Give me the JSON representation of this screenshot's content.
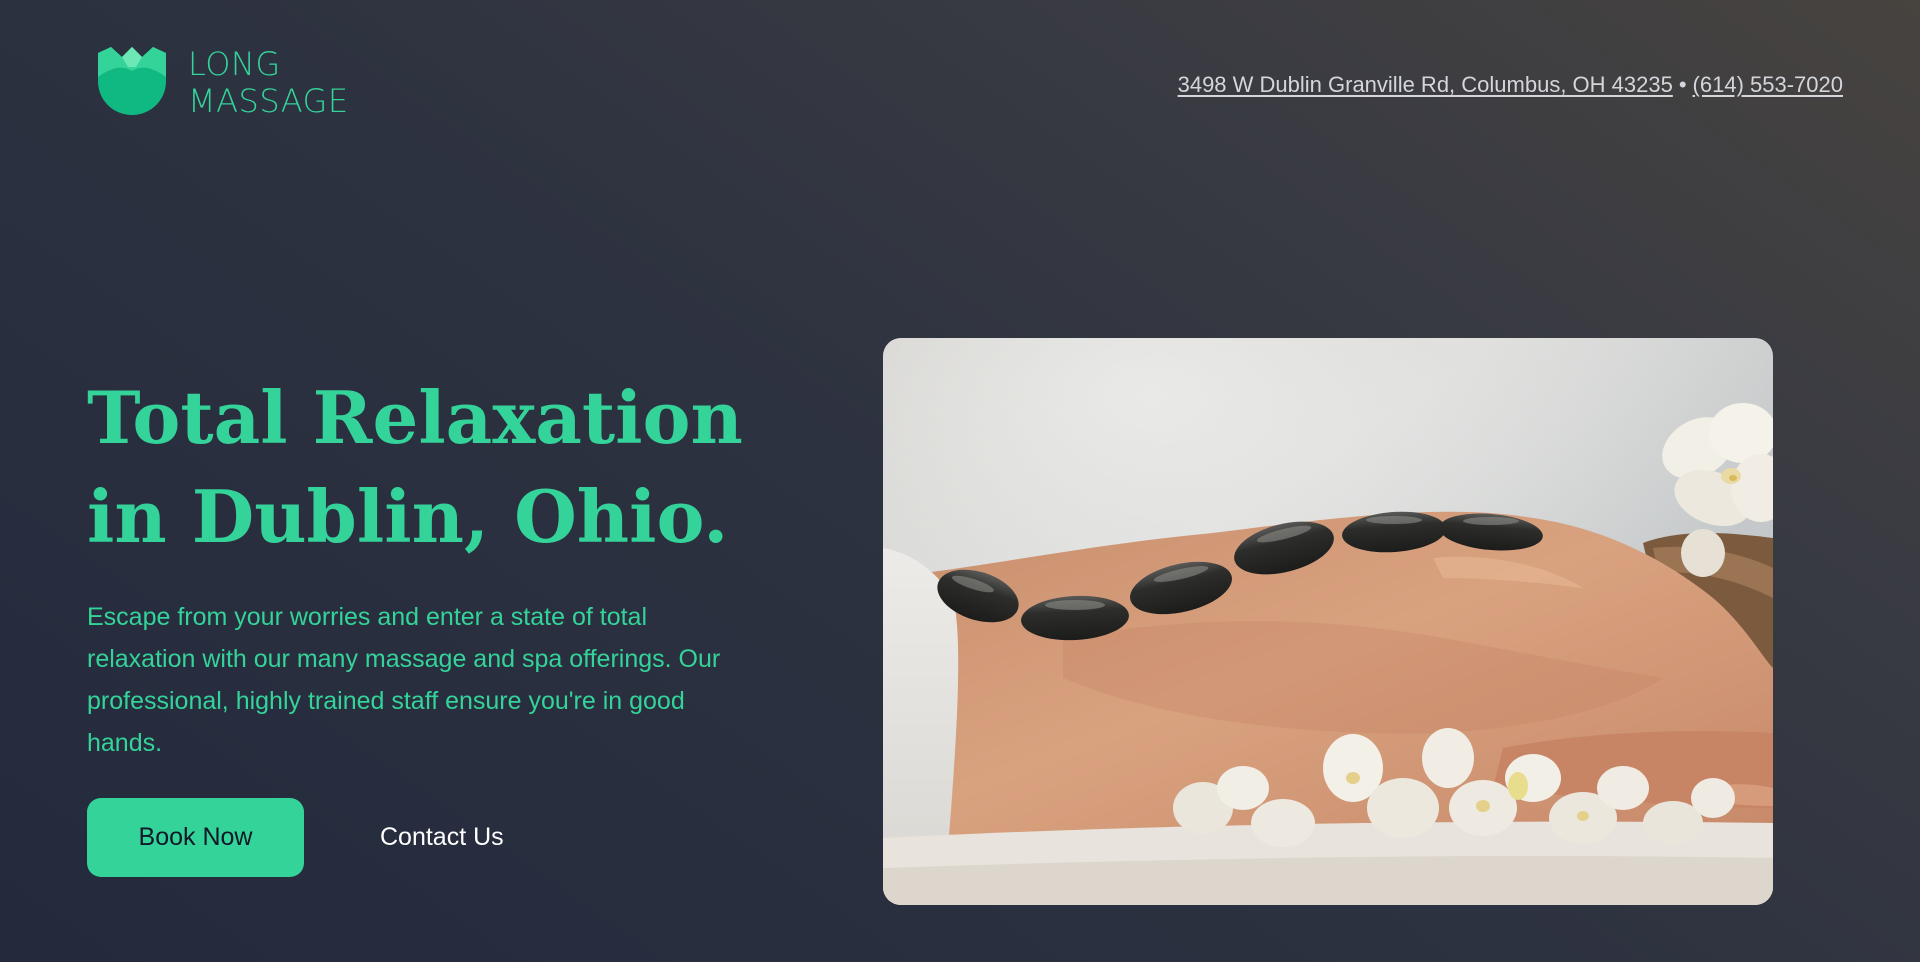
{
  "brand": {
    "name_line1": "LONG",
    "name_line2": "MASSAGE",
    "icon": "lotus-icon"
  },
  "contact": {
    "address": "3498 W Dublin Granville Rd, Columbus, OH 43235",
    "separator": "•",
    "phone": "(614) 553-7020"
  },
  "hero": {
    "heading_line1": "Total Relaxation",
    "heading_line2": "in Dublin, Ohio.",
    "description": "Escape from your worries and enter a state of total relaxation with our many massage and spa offerings. Our professional, highly trained staff ensure you're in good hands.",
    "book_button": "Book Now",
    "contact_button": "Contact Us",
    "photo_alt": "hot-stone-massage-photo"
  },
  "colors": {
    "accent": "#34d399",
    "background_dark": "#232a3c",
    "background_warm": "#47433f",
    "link_text": "#d4d6db",
    "button_text": "#111827"
  }
}
